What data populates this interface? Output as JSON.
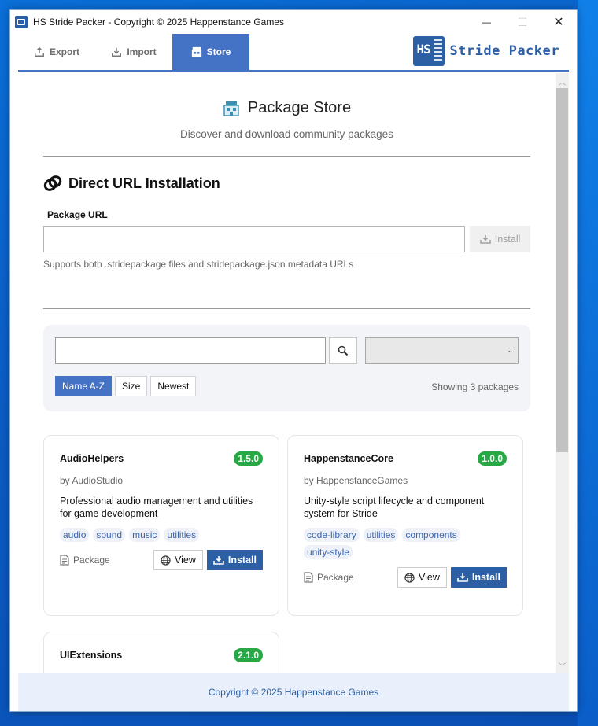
{
  "window": {
    "title": "HS Stride Packer - Copyright © 2025 Happenstance Games",
    "controls": {
      "minimize": "—",
      "maximize": "☐",
      "close": "✕"
    }
  },
  "tabs": [
    {
      "label": "Export",
      "icon": "export-icon",
      "active": false
    },
    {
      "label": "Import",
      "icon": "import-icon",
      "active": false
    },
    {
      "label": "Store",
      "icon": "store-icon",
      "active": true
    }
  ],
  "brand": {
    "logo_text": "HS",
    "name": "Stride Packer"
  },
  "store": {
    "title": "Package Store",
    "subtitle": "Discover and download community packages"
  },
  "direct_url": {
    "title": "Direct URL Installation",
    "field_label": "Package URL",
    "url_value": "",
    "install_label": "Install",
    "hint": "Supports both .stridepackage files and stridepackage.json metadata URLs"
  },
  "filters": {
    "search_value": "",
    "category_value": "",
    "sort_options": [
      "Name A-Z",
      "Size",
      "Newest"
    ],
    "active_sort": "Name A-Z",
    "showing": "Showing 3 packages"
  },
  "packages": [
    {
      "name": "AudioHelpers",
      "version": "1.5.0",
      "author": "by AudioStudio",
      "description": "Professional audio management and utilities for game development",
      "tags": [
        "audio",
        "sound",
        "music",
        "utilities"
      ],
      "type": "Package",
      "view_label": "View",
      "install_label": "Install"
    },
    {
      "name": "HappenstanceCore",
      "version": "1.0.0",
      "author": "by HappenstanceGames",
      "description": "Unity-style script lifecycle and component system for Stride",
      "tags": [
        "code-library",
        "utilities",
        "components",
        "unity-style"
      ],
      "type": "Package",
      "view_label": "View",
      "install_label": "Install"
    },
    {
      "name": "UIExtensions",
      "version": "2.1.0"
    }
  ],
  "footer": {
    "text": "Copyright © 2025 Happenstance Games"
  },
  "colors": {
    "accent": "#4472c4",
    "primary_button": "#2c5fa3",
    "badge": "#28a745",
    "tag_bg": "#eef2f8",
    "footer_bg": "#eaf0fb"
  }
}
